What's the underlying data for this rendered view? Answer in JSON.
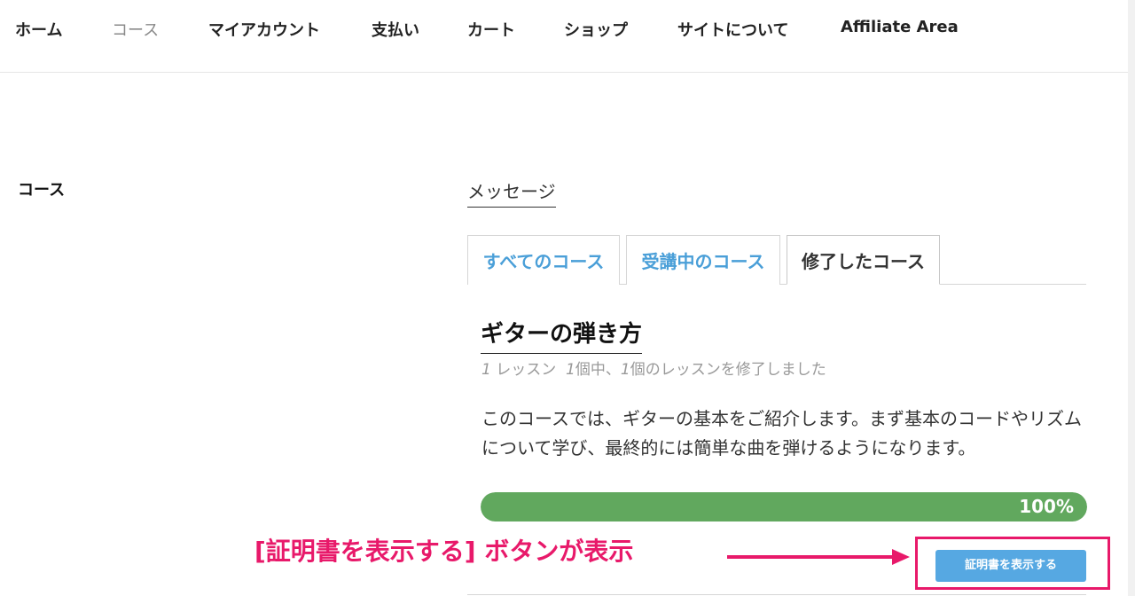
{
  "nav": {
    "items": [
      {
        "label": "ホーム"
      },
      {
        "label": "コース"
      },
      {
        "label": "マイアカウント"
      },
      {
        "label": "支払い"
      },
      {
        "label": "カート"
      },
      {
        "label": "ショップ"
      },
      {
        "label": "サイトについて"
      },
      {
        "label": "Affiliate Area"
      }
    ],
    "active_index": 1
  },
  "sidebar": {
    "title": "コース"
  },
  "main": {
    "messages_link": "メッセージ",
    "tabs": [
      {
        "label": "すべてのコース"
      },
      {
        "label": "受講中のコース"
      },
      {
        "label": "修了したコース"
      }
    ],
    "active_tab": 2,
    "course": {
      "title": "ギターの弾き方",
      "lessons_count": "1",
      "lessons_label": " レッスン",
      "completed_of": "1",
      "completed_mid": "個中、",
      "completed_count": "1",
      "completed_suffix": "個のレッスンを修了しました",
      "description": "このコースでは、ギターの基本をご紹介します。まず基本のコードやリズムについて学び、最終的には簡単な曲を弾けるようになります。",
      "progress_percent": 100,
      "progress_label": "100%",
      "certificate_button": "証明書を表示する"
    }
  },
  "annotation": {
    "text": "[証明書を表示する] ボタンが表示",
    "color": "#e8196a"
  },
  "colors": {
    "tab_link": "#4a9fd8",
    "progress": "#61a85e",
    "button": "#56a8e2"
  }
}
